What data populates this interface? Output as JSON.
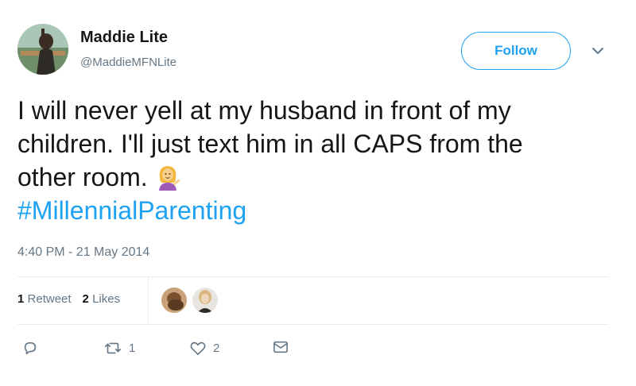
{
  "user": {
    "display_name": "Maddie Lite",
    "handle": "@MaddieMFNLite"
  },
  "follow_button": {
    "label": "Follow"
  },
  "tweet": {
    "text_line_1": "I will never yell at my husband in front of my",
    "text_line_2": "children. I'll just text him in all CAPS from the",
    "text_line_3": "other room.",
    "emoji": "person-tipping-hand-emoji",
    "hashtag": "#MillennialParenting",
    "timestamp": "4:40 PM - 21 May 2014"
  },
  "stats": {
    "retweet_count": "1",
    "retweet_label": "Retweet",
    "like_count": "2",
    "like_label": "Likes"
  },
  "actions": {
    "reply_count": "",
    "retweet_count": "1",
    "like_count": "2"
  },
  "colors": {
    "accent": "#1da1f2",
    "secondary_text": "#657786",
    "primary_text": "#14171a",
    "divider": "#e6ecf0"
  },
  "icons": [
    "reply-icon",
    "retweet-icon",
    "heart-icon",
    "message-icon",
    "chevron-down-icon"
  ]
}
